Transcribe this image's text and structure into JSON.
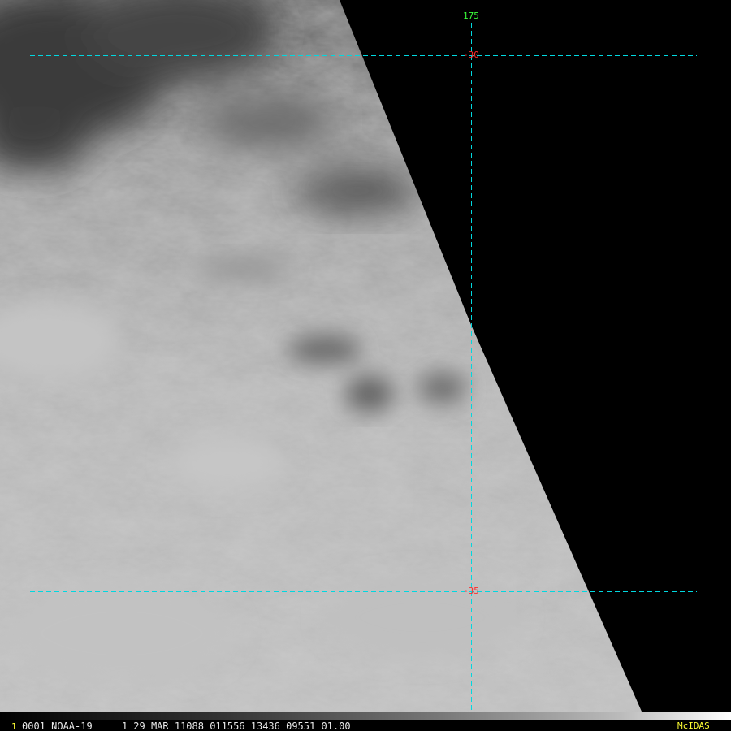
{
  "satellite_image": {
    "grid_labels": {
      "lon_top": "175",
      "lat_upper": "-30",
      "lat_lower": "-35"
    },
    "status_bar": {
      "frame_number": "1",
      "text": "0001 NOAA-19     1 29 MAR 11088 011556 13436 09551 01.00",
      "logo": "McIDAS"
    },
    "colors": {
      "grid_line": "#00d8e0",
      "lat_label": "#ff2a2a",
      "lon_label": "#39ff39",
      "status_highlight": "#ffff33",
      "background": "#000000"
    }
  }
}
